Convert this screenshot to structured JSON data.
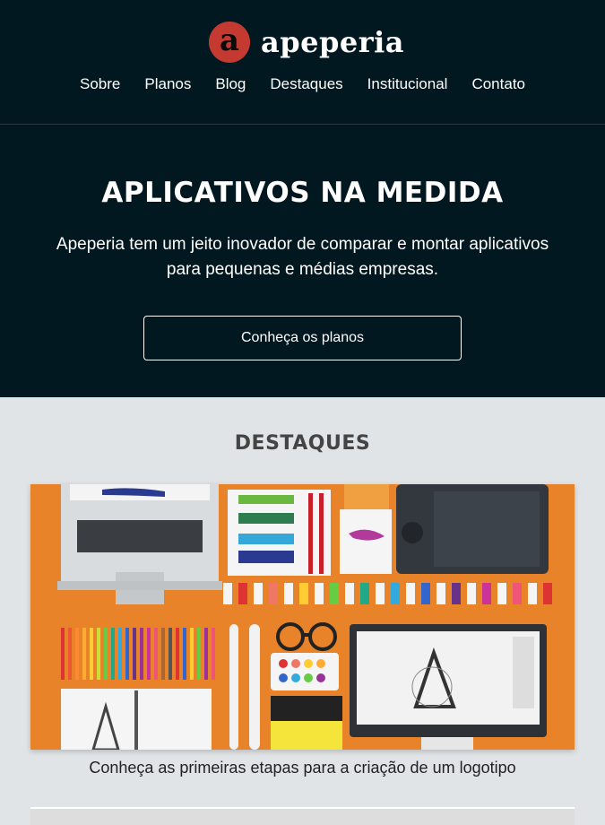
{
  "header": {
    "logo_letter": "a",
    "brand": "apeperia",
    "nav": [
      "Sobre",
      "Planos",
      "Blog",
      "Destaques",
      "Institucional",
      "Contato"
    ]
  },
  "hero": {
    "title": "APLICATIVOS NA MEDIDA",
    "subtitle": "Apeperia tem um jeito inovador de comparar e montar aplicativos para pequenas e médias empresas.",
    "cta": "Conheça os planos"
  },
  "highlights": {
    "title": "DESTAQUES",
    "items": [
      {
        "caption": "Conheça as primeiras etapas para a criação de um logotipo"
      }
    ]
  },
  "colors": {
    "dark_bg": "#021820",
    "brand_red": "#c43a30",
    "page_bg": "#e1e4e6",
    "card_orange": "#e8832a"
  }
}
